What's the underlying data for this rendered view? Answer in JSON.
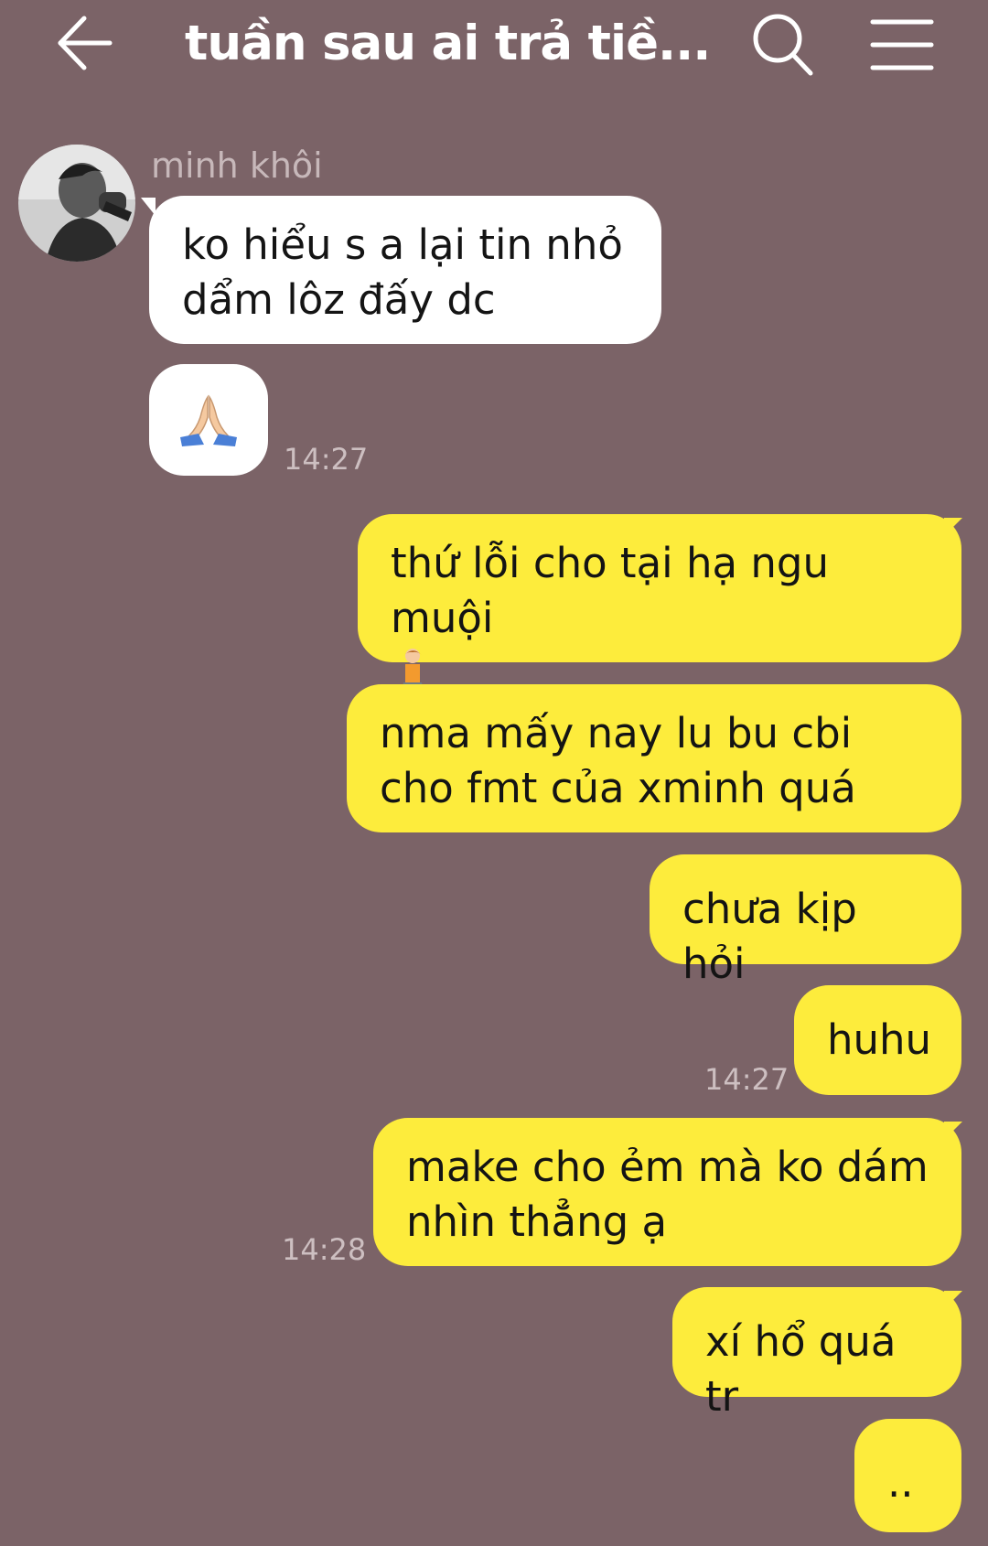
{
  "header": {
    "title": "tuần sau ai trả tiề...",
    "back_icon": "arrow-left-icon",
    "search_icon": "search-icon",
    "menu_icon": "hamburger-menu-icon"
  },
  "contact": {
    "name": "minh khôi"
  },
  "messages": [
    {
      "side": "in",
      "text": "ko hiểu s a lại tin nhỏ dẩm lôz đấy dc"
    },
    {
      "side": "in",
      "emoji": "folded-hands-emoji",
      "time": "14:27"
    },
    {
      "side": "out",
      "text": "thứ lỗi cho tại hạ ngu muội",
      "emoji": "kneeling-person-emoji"
    },
    {
      "side": "out",
      "text": "nma mấy nay lu bu cbi cho fmt của xminh quá"
    },
    {
      "side": "out",
      "text": "chưa kịp hỏi"
    },
    {
      "side": "out",
      "text": "huhu",
      "time": "14:27"
    },
    {
      "side": "out",
      "text": "make cho ẻm mà ko dám nhìn thẳng ạ",
      "time": "14:28"
    },
    {
      "side": "out",
      "text": "xí hổ quá tr"
    },
    {
      "side": "out",
      "text": ".."
    }
  ],
  "colors": {
    "background": "#7b6367",
    "incoming_bubble": "#ffffff",
    "outgoing_bubble": "#fdec3c",
    "timestamp": "#cdbfc1",
    "sender_name": "#c7b8ba"
  }
}
